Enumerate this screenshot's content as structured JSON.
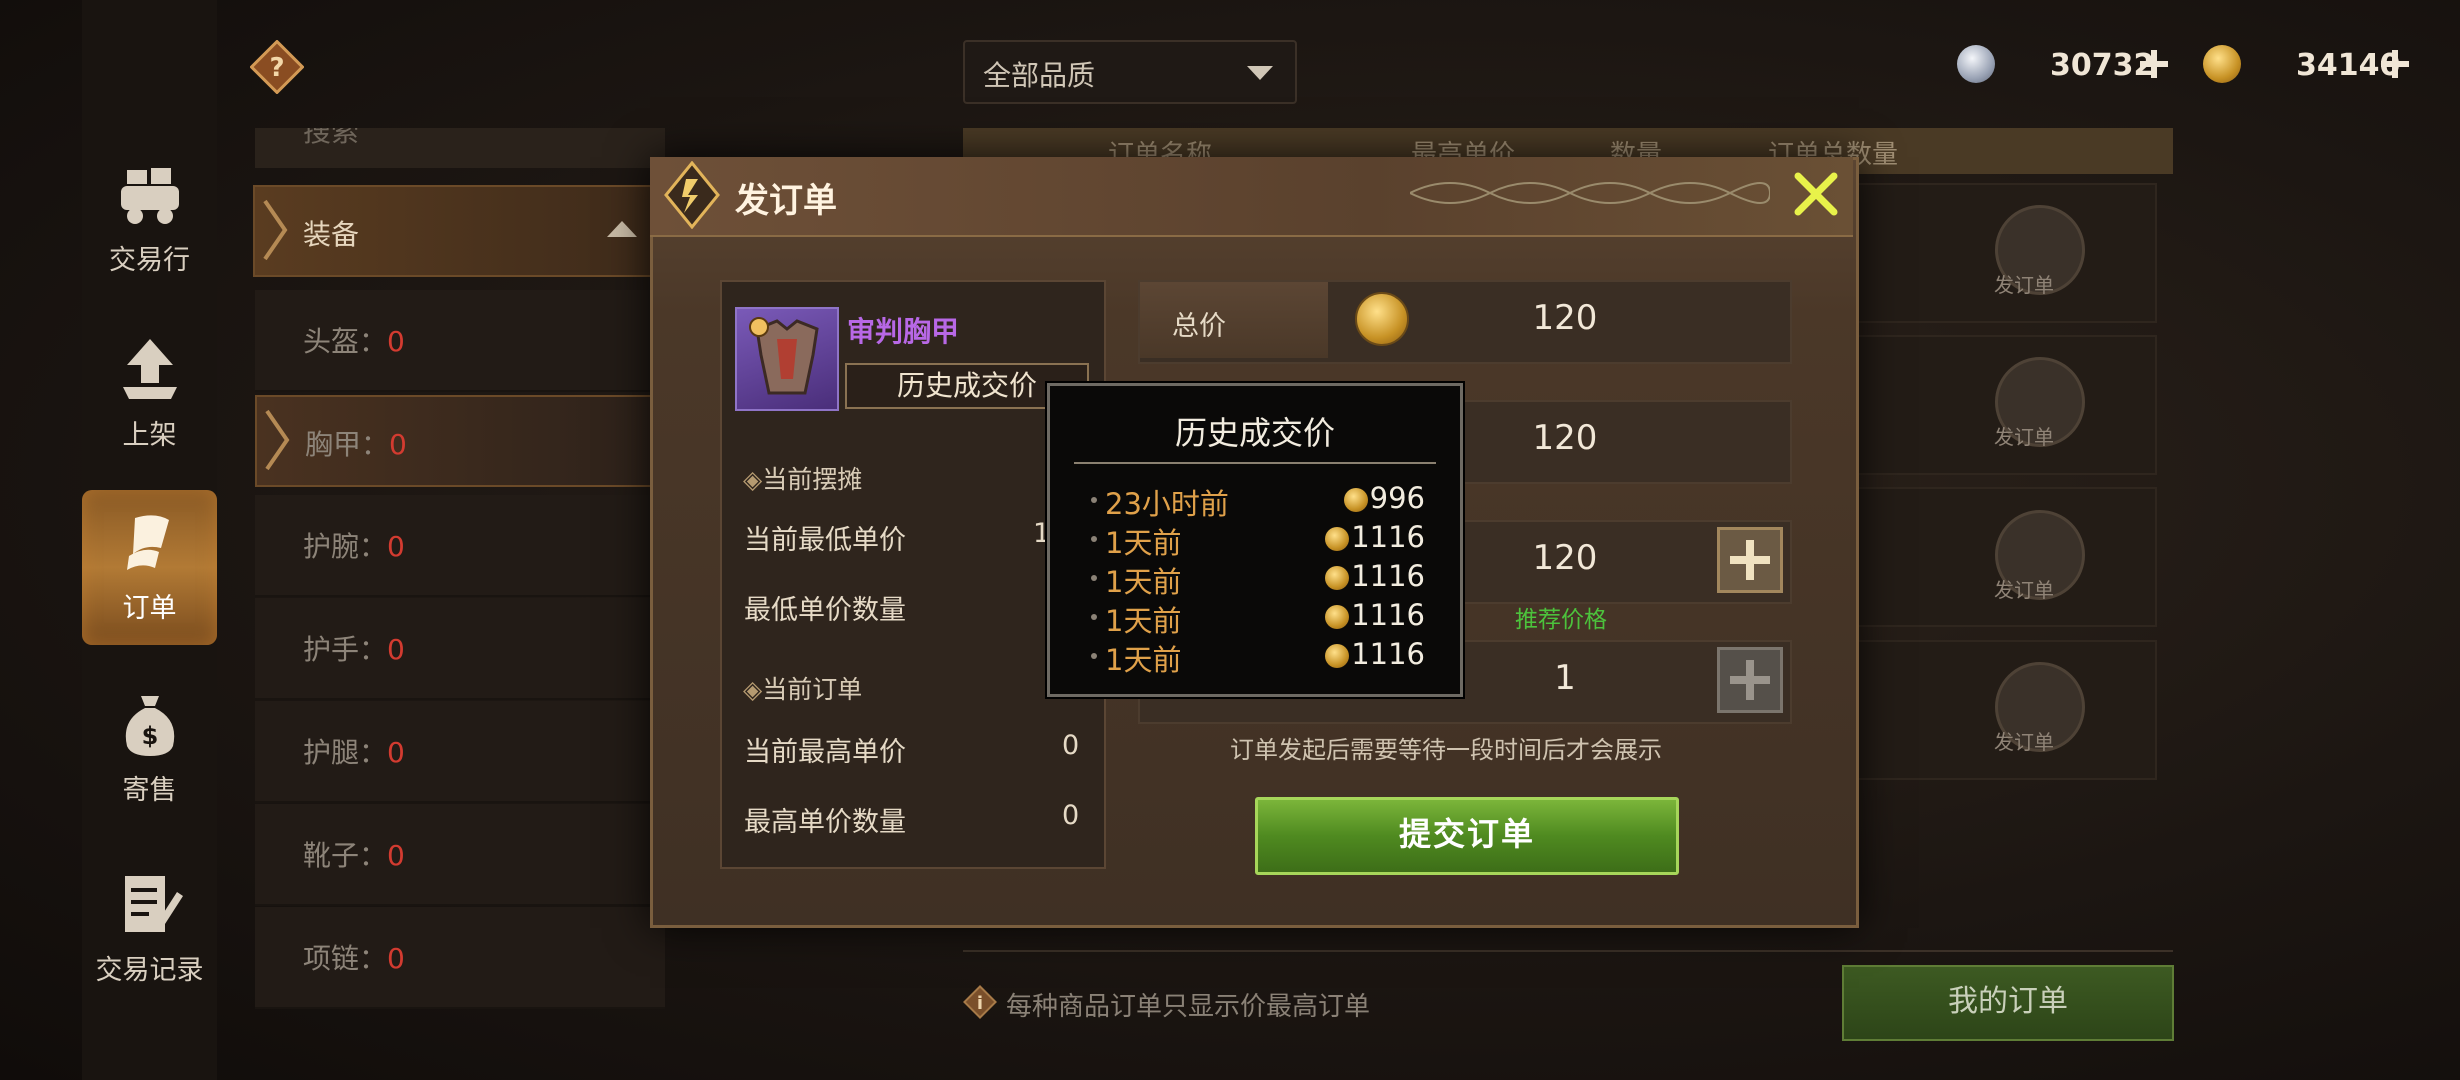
{
  "topbar": {
    "quality_filter": "全部品质",
    "silver_amount": "30732",
    "gold_amount": "34140"
  },
  "nav": {
    "items": [
      {
        "label": "交易行",
        "icon": "market-icon"
      },
      {
        "label": "上架",
        "icon": "upload-icon"
      },
      {
        "label": "订单",
        "icon": "order-icon",
        "active": true
      },
      {
        "label": "寄售",
        "icon": "moneybag-icon"
      },
      {
        "label": "交易记录",
        "icon": "record-icon"
      }
    ]
  },
  "categories": {
    "search_partial": "搜索",
    "header": "装备",
    "items": [
      {
        "label": "头盔：",
        "count": "0"
      },
      {
        "label": "胸甲：",
        "count": "0",
        "active": true
      },
      {
        "label": "护腕：",
        "count": "0"
      },
      {
        "label": "护手：",
        "count": "0"
      },
      {
        "label": "护腿：",
        "count": "0"
      },
      {
        "label": "靴子：",
        "count": "0"
      },
      {
        "label": "项链：",
        "count": "0"
      }
    ]
  },
  "table": {
    "headers": [
      "订单名称",
      "最高单价",
      "数量",
      "订单总数量"
    ],
    "order_button_label": "发订单"
  },
  "footer": {
    "tip": "每种商品订单只显示价最高订单",
    "my_orders": "我的订单"
  },
  "modal": {
    "title": "发订单",
    "item_name": "审判胸甲",
    "history_button": "历史成交价",
    "current_stall_heading": "当前摆摊",
    "current_lowest_price_label": "当前最低单价",
    "current_lowest_price_value": "1",
    "lowest_price_qty_label": "最低单价数量",
    "current_orders_heading": "当前订单",
    "current_highest_price_label": "当前最高单价",
    "current_highest_price_value": "0",
    "highest_price_qty_label": "最高单价数量",
    "highest_price_qty_value": "0",
    "total_label": "总价",
    "total_value": "120",
    "unit_value": "120",
    "price_value": "120",
    "recommended_label": "推荐价格",
    "quantity_value": "1",
    "notice": "订单发起后需要等待一段时间后才会展示",
    "submit": "提交订单"
  },
  "history_popup": {
    "title": "历史成交价",
    "rows": [
      {
        "when": "23小时前",
        "price": "996"
      },
      {
        "when": "1天前",
        "price": "1116"
      },
      {
        "when": "1天前",
        "price": "1116"
      },
      {
        "when": "1天前",
        "price": "1116"
      },
      {
        "when": "1天前",
        "price": "1116"
      }
    ]
  },
  "colors": {
    "accent_gold": "#e0a14a",
    "item_purple": "#b868e6",
    "count_red": "#d33b30",
    "recommend_green": "#4cc23c",
    "submit_green": "#5e9a28"
  }
}
